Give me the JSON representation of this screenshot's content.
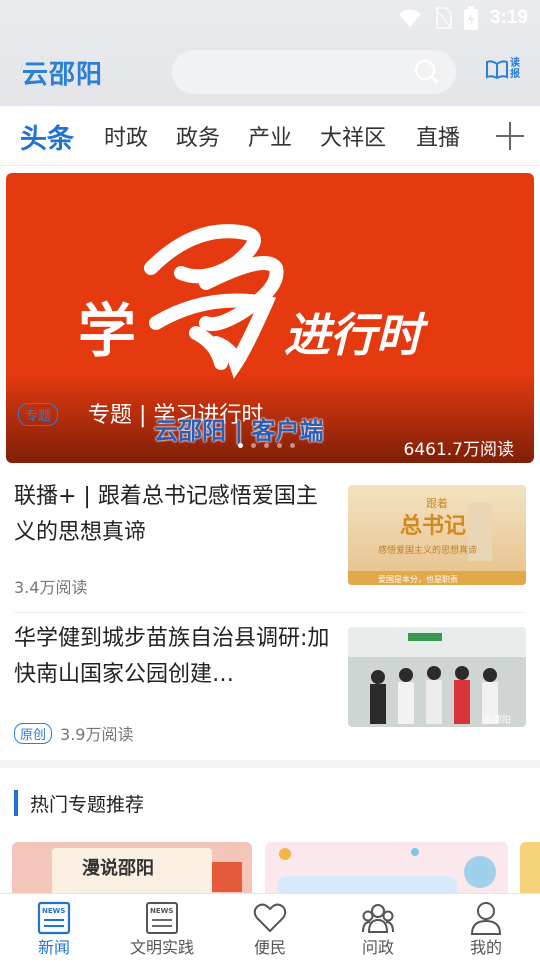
{
  "status_bar": {
    "time": "3:19"
  },
  "header": {
    "logo": "云邵阳",
    "search_placeholder": "",
    "read_paper_label": "读报"
  },
  "tabs": [
    {
      "label": "头条",
      "active": true
    },
    {
      "label": "时政",
      "active": false
    },
    {
      "label": "政务",
      "active": false
    },
    {
      "label": "产业",
      "active": false
    },
    {
      "label": "大祥区",
      "active": false
    },
    {
      "label": "直播",
      "active": false
    }
  ],
  "banner": {
    "art_text_1": "学",
    "art_text_2": "进行时",
    "tag": "专题",
    "caption": "专题 | 学习进行时",
    "brand": "云邵阳 | 客户端",
    "views": "6461.7万阅读",
    "slide_count": 5,
    "active_slide": 1
  },
  "news": [
    {
      "title": "联播+ | 跟着总书记感悟爱国主义的思想真谛",
      "badge": "",
      "views": "3.4万阅读",
      "thumb_text_1": "跟着",
      "thumb_text_2": "总书记",
      "thumb_text_3": "感悟爱国主义的思想真谛",
      "thumb_text_4": "爱国是本分，也是职责"
    },
    {
      "title": "华学健到城步苗族自治县调研:加快南山国家公园创建…",
      "badge": "原创",
      "views": "3.9万阅读",
      "thumb_text_1": "云邵阳"
    }
  ],
  "section": {
    "title": "热门专题推荐"
  },
  "cards": [
    {
      "text": "漫说邵阳"
    },
    {
      "text": ""
    }
  ],
  "bottom_nav": [
    {
      "label": "新闻",
      "active": true
    },
    {
      "label": "文明实践",
      "active": false
    },
    {
      "label": "便民",
      "active": false
    },
    {
      "label": "问政",
      "active": false
    },
    {
      "label": "我的",
      "active": false
    }
  ],
  "colors": {
    "brand_blue": "#1f73d1",
    "banner_red": "#e5390f"
  }
}
